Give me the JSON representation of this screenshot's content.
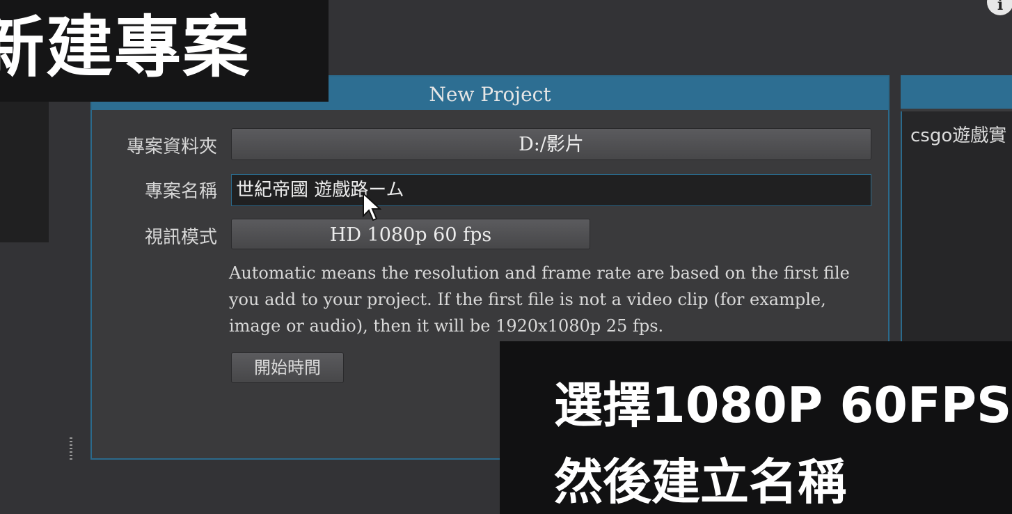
{
  "dialog": {
    "title": "New Project",
    "folder": {
      "label": "專案資料夾",
      "value": "D:/影片"
    },
    "name": {
      "label": "專案名稱",
      "value": "世紀帝國 遊戲路ーム"
    },
    "video_mode": {
      "label": "視訊模式",
      "value": "HD 1080p 60 fps"
    },
    "description": "Automatic means the resolution and frame rate are based on the first file you add to your project. If the first file is not a video clip (for example, image or audio), then it will be 1920x1080p 25 fps.",
    "start_time_label": "開始時間"
  },
  "side_panel": {
    "text": "csgo遊戲實"
  },
  "overlays": {
    "title": "新建專案",
    "caption_line1": "選擇1080P 60FPS",
    "caption_line2": "然後建立名稱"
  },
  "icons": {
    "info": "info-icon",
    "cursor": "mouse-pointer-icon"
  },
  "colors": {
    "accent": "#2d6e92",
    "background": "#333336"
  }
}
